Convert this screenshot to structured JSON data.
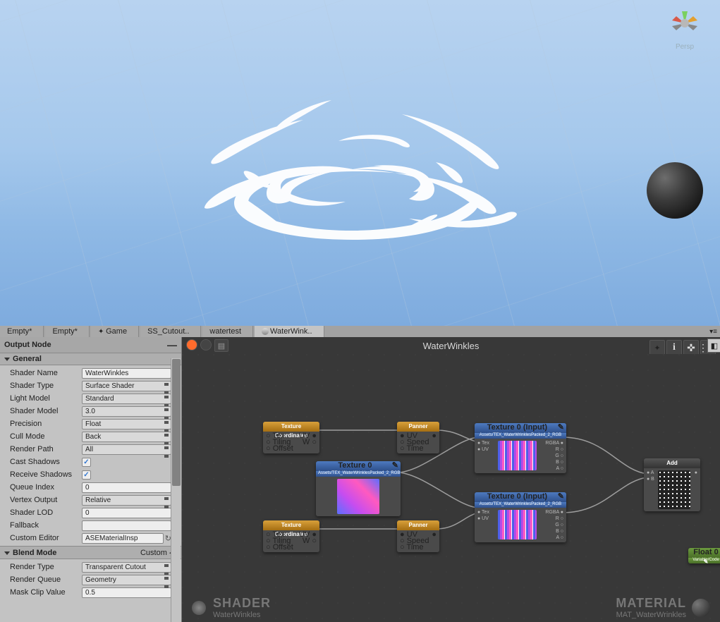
{
  "scene": {
    "persp_label": "Persp"
  },
  "tabs": [
    "Empty*",
    "Empty*",
    "Game",
    "SS_Cutout..",
    "watertest",
    "WaterWink.."
  ],
  "active_tab": 5,
  "inspector": {
    "title": "Output Node",
    "sections": {
      "general": {
        "label": "General",
        "props": {
          "shader_name": {
            "label": "Shader Name",
            "value": "WaterWinkles"
          },
          "shader_type": {
            "label": "Shader Type",
            "value": "Surface Shader"
          },
          "light_model": {
            "label": "Light Model",
            "value": "Standard"
          },
          "shader_model": {
            "label": "Shader Model",
            "value": "3.0"
          },
          "precision": {
            "label": "Precision",
            "value": "Float"
          },
          "cull_mode": {
            "label": "Cull Mode",
            "value": "Back"
          },
          "render_path": {
            "label": "Render Path",
            "value": "All"
          },
          "cast_shadows": {
            "label": "Cast Shadows",
            "value": true
          },
          "receive_shadows": {
            "label": "Receive Shadows",
            "value": true
          },
          "queue_index": {
            "label": "Queue Index",
            "value": "0"
          },
          "vertex_output": {
            "label": "Vertex Output",
            "value": "Relative"
          },
          "shader_lod": {
            "label": "Shader LOD",
            "value": "0"
          },
          "fallback": {
            "label": "Fallback",
            "value": ""
          },
          "custom_editor": {
            "label": "Custom Editor",
            "value": "ASEMaterialInsp"
          }
        }
      },
      "blend_mode": {
        "label": "Blend Mode",
        "hint": "Custom",
        "props": {
          "render_type": {
            "label": "Render Type",
            "value": "Transparent Cutout"
          },
          "render_queue": {
            "label": "Render Queue",
            "value": "Geometry"
          },
          "mask_clip": {
            "label": "Mask Clip Value",
            "value": "0.5"
          }
        }
      }
    }
  },
  "editor": {
    "title": "WaterWinkles",
    "footer": {
      "shader_label": "SHADER",
      "shader_name": "WaterWinkles",
      "material_label": "MATERIAL",
      "material_name": "MAT_WaterWrinkles"
    },
    "nodes": {
      "tc1": {
        "title": "Texture Coordinates",
        "ports": [
          "Tex",
          "Tiling",
          "Offset"
        ],
        "out": [
          "UV",
          "W"
        ]
      },
      "tc2": {
        "title": "Texture Coordinates",
        "ports": [
          "Tex",
          "Tiling",
          "Offset"
        ],
        "out": [
          "UV",
          "W"
        ]
      },
      "panner1": {
        "title": "Panner",
        "ports": [
          "UV",
          "Speed",
          "Time"
        ]
      },
      "panner2": {
        "title": "Panner",
        "ports": [
          "UV",
          "Speed",
          "Time"
        ]
      },
      "tex0": {
        "title": "Texture 0",
        "sub": "Assets/TEX_WaterWrinklesPacked_2_RGB"
      },
      "samp1": {
        "title": "Texture 0 (Input)",
        "sub": "Assets/TEX_WaterWrinklesPacked_2_RGB",
        "ports": [
          "Tex",
          "UV"
        ],
        "out": [
          "RGBA",
          "R",
          "G",
          "B",
          "A"
        ]
      },
      "samp2": {
        "title": "Texture 0 (Input)",
        "sub": "Assets/TEX_WaterWrinklesPacked_2_RGB",
        "ports": [
          "Tex",
          "UV"
        ],
        "out": [
          "RGBA",
          "R",
          "G",
          "B",
          "A"
        ]
      },
      "add": {
        "title": "Add",
        "ports": [
          "A",
          "B"
        ]
      },
      "float0": {
        "title": "Float 0",
        "sub": "Variable/Code"
      }
    }
  }
}
